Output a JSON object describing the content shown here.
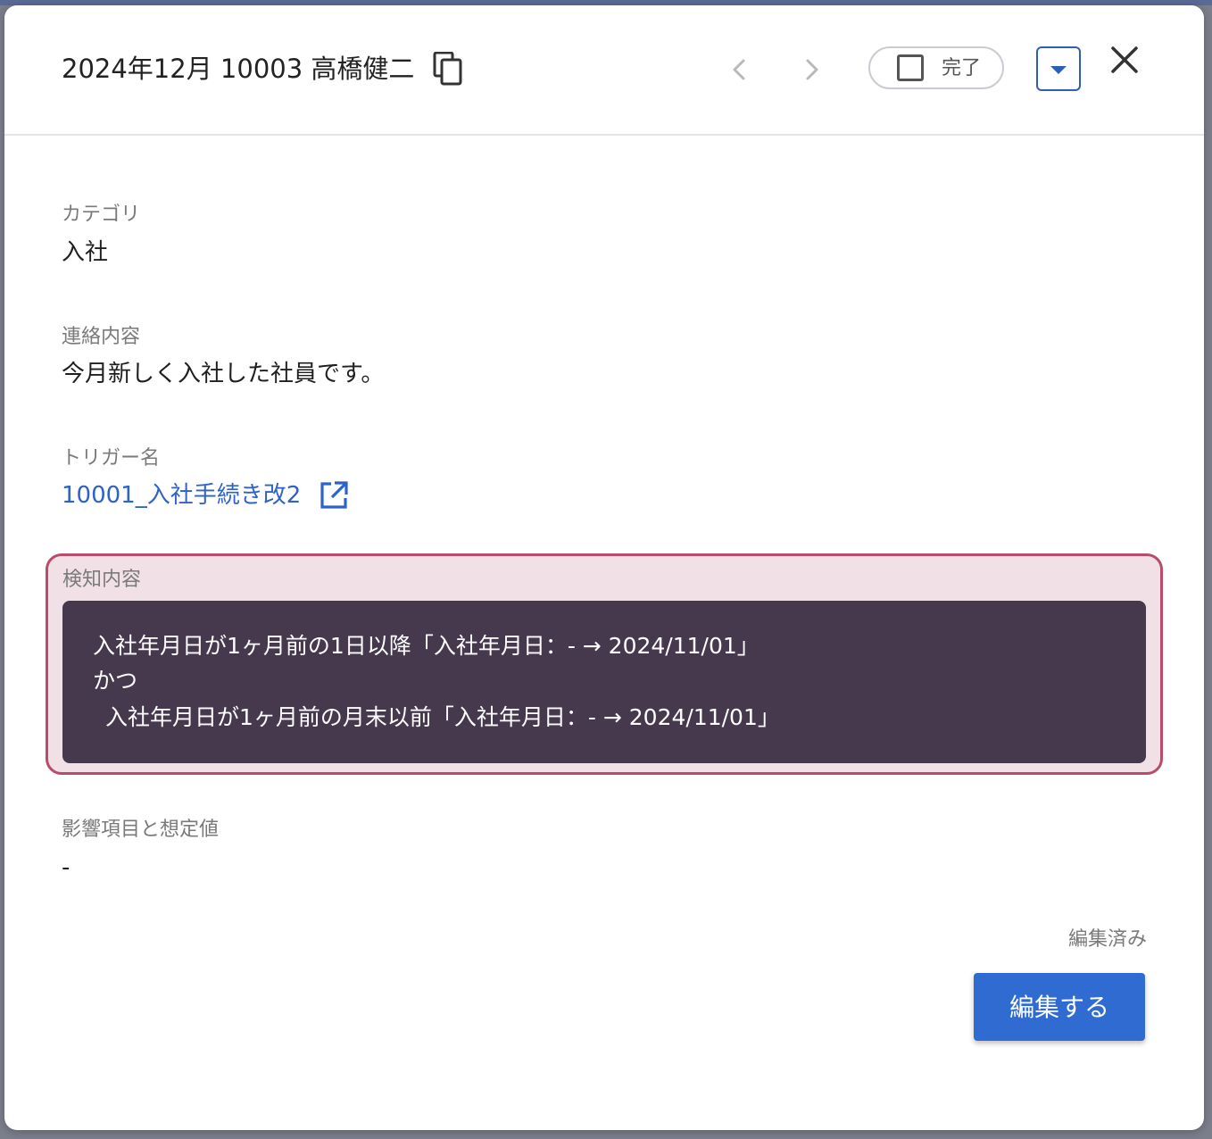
{
  "header": {
    "title": "2024年12月 10003 高橋健二",
    "done_label": "完了"
  },
  "fields": {
    "category": {
      "label": "カテゴリ",
      "value": "入社"
    },
    "contact": {
      "label": "連絡内容",
      "value": "今月新しく入社した社員です。"
    },
    "trigger": {
      "label": "トリガー名",
      "link_text": "10001_入社手続き改2"
    },
    "detection": {
      "label": "検知内容",
      "lines": [
        "入社年月日が1ヶ月前の1日以降「入社年月日：- → 2024/11/01」",
        "かつ",
        "入社年月日が1ヶ月前の月末以前「入社年月日：- → 2024/11/01」"
      ]
    },
    "impact": {
      "label": "影響項目と想定値",
      "value": "-"
    }
  },
  "footer": {
    "edited_status": "編集済み",
    "edit_button_label": "編集する"
  },
  "colors": {
    "accent": "#2f6bd1",
    "link": "#2e62c8",
    "highlight_border": "#b84c6a",
    "highlight_bg": "#f1e1e6",
    "detection_bg": "#46394d"
  }
}
